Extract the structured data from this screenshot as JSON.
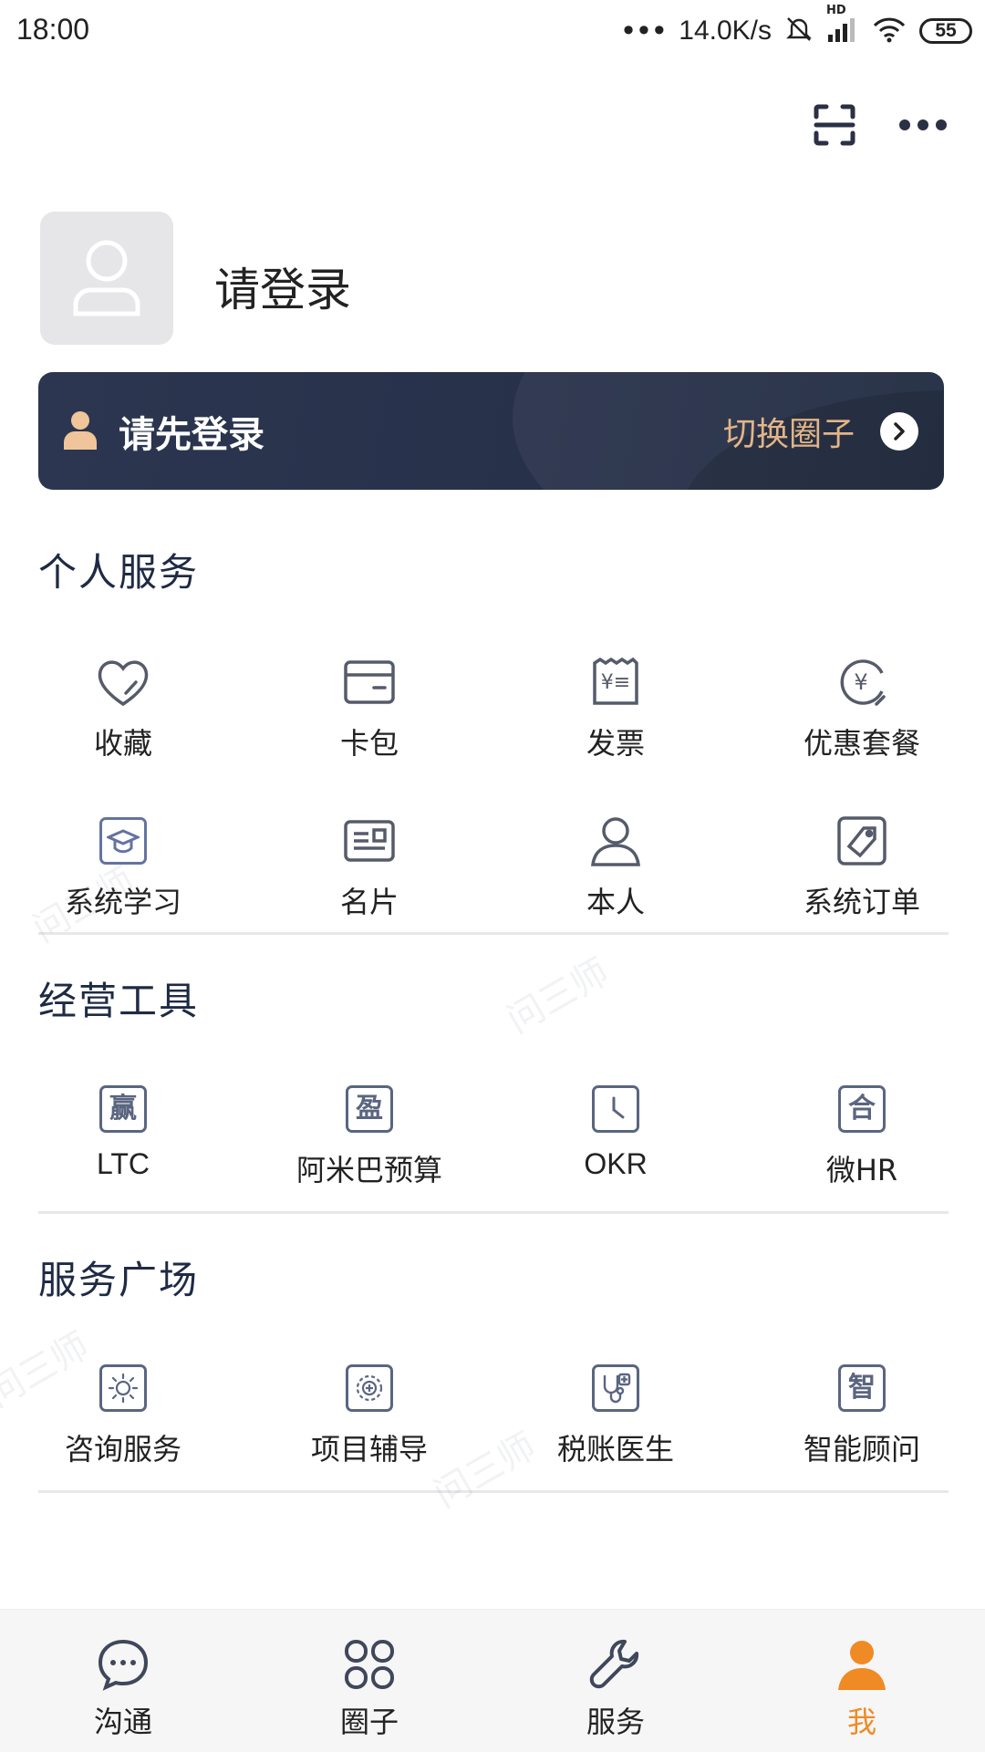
{
  "status_bar": {
    "time": "18:00",
    "network_speed": "14.0K/s",
    "battery": "55",
    "hd_label": "HD"
  },
  "top_actions": [
    {
      "icon": "scan-icon"
    },
    {
      "icon": "more-icon"
    }
  ],
  "profile": {
    "name": "请登录",
    "avatar_icon": "user-avatar-icon"
  },
  "banner": {
    "title": "请先登录",
    "switch_label": "切换圈子",
    "accent_color": "#e3b487"
  },
  "personal_services": {
    "title": "个人服务",
    "items": [
      {
        "label": "收藏",
        "icon": "heart-icon"
      },
      {
        "label": "卡包",
        "icon": "card-wallet-icon"
      },
      {
        "label": "发票",
        "icon": "invoice-icon"
      },
      {
        "label": "优惠套餐",
        "icon": "discount-icon"
      },
      {
        "label": "系统学习",
        "icon": "graduation-cap-icon"
      },
      {
        "label": "名片",
        "icon": "business-card-icon"
      },
      {
        "label": "本人",
        "icon": "person-icon"
      },
      {
        "label": "系统订单",
        "icon": "tag-icon"
      }
    ]
  },
  "business_tools": {
    "title": "经营工具",
    "items": [
      {
        "label": "LTC",
        "glyph": "赢",
        "icon": "ltc-icon"
      },
      {
        "label": "阿米巴预算",
        "glyph": "盈",
        "icon": "amoeba-budget-icon"
      },
      {
        "label": "OKR",
        "glyph": "",
        "icon": "clock-icon"
      },
      {
        "label": "微HR",
        "glyph": "合",
        "icon": "hr-icon"
      }
    ]
  },
  "service_plaza": {
    "title": "服务广场",
    "items": [
      {
        "label": "咨询服务",
        "icon": "consulting-icon"
      },
      {
        "label": "项目辅导",
        "icon": "project-coaching-icon"
      },
      {
        "label": "税账医生",
        "icon": "tax-doctor-icon"
      },
      {
        "label": "智能顾问",
        "glyph": "智",
        "icon": "smart-advisor-icon"
      }
    ]
  },
  "watermark_text": "问三师",
  "tabbar": {
    "items": [
      {
        "label": "沟通",
        "icon": "chat-icon"
      },
      {
        "label": "圈子",
        "icon": "circles-icon"
      },
      {
        "label": "服务",
        "icon": "wrench-icon"
      },
      {
        "label": "我",
        "icon": "me-icon",
        "active": true
      }
    ],
    "active_color": "#f08a24"
  }
}
